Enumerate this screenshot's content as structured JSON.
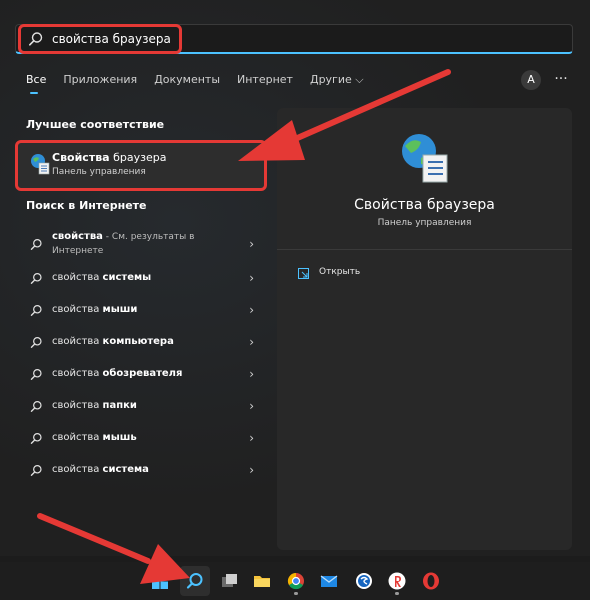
{
  "search": {
    "query": "свойства браузера"
  },
  "tabs": [
    {
      "label": "Все",
      "active": true
    },
    {
      "label": "Приложения"
    },
    {
      "label": "Документы"
    },
    {
      "label": "Интернет"
    },
    {
      "label": "Другие ⌵"
    }
  ],
  "header": {
    "avatar_letter": "A",
    "more_label": "···"
  },
  "best_match": {
    "section_title": "Лучшее соответствие",
    "title_bold": "Свойства",
    "title_rest": " браузера",
    "subtitle": "Панель управления",
    "icon": "internet-options-icon"
  },
  "web": {
    "section_title": "Поиск в Интернете",
    "items": [
      {
        "prefix": "свойства",
        "bold": "",
        "muted": " - См. результаты в Интернете"
      },
      {
        "prefix": "свойства ",
        "bold": "системы",
        "muted": ""
      },
      {
        "prefix": "свойства ",
        "bold": "мыши",
        "muted": ""
      },
      {
        "prefix": "свойства ",
        "bold": "компьютера",
        "muted": ""
      },
      {
        "prefix": "свойства ",
        "bold": "обозревателя",
        "muted": ""
      },
      {
        "prefix": "свойства ",
        "bold": "папки",
        "muted": ""
      },
      {
        "prefix": "свойства ",
        "bold": "мышь",
        "muted": ""
      },
      {
        "prefix": "свойства ",
        "bold": "система",
        "muted": ""
      }
    ],
    "chevron": "›"
  },
  "detail": {
    "title": "Свойства браузера",
    "subtitle": "Панель управления",
    "actions": [
      {
        "label": "Открыть",
        "icon": "open-icon"
      }
    ]
  },
  "taskbar": {
    "items": [
      "start-icon",
      "search-icon",
      "task-view-icon",
      "file-explorer-icon",
      "chrome-icon",
      "mail-icon",
      "skype-icon",
      "yandex-browser-icon",
      "opera-icon"
    ]
  },
  "colors": {
    "accent": "#4cc2ff",
    "annotation": "#e53935"
  }
}
